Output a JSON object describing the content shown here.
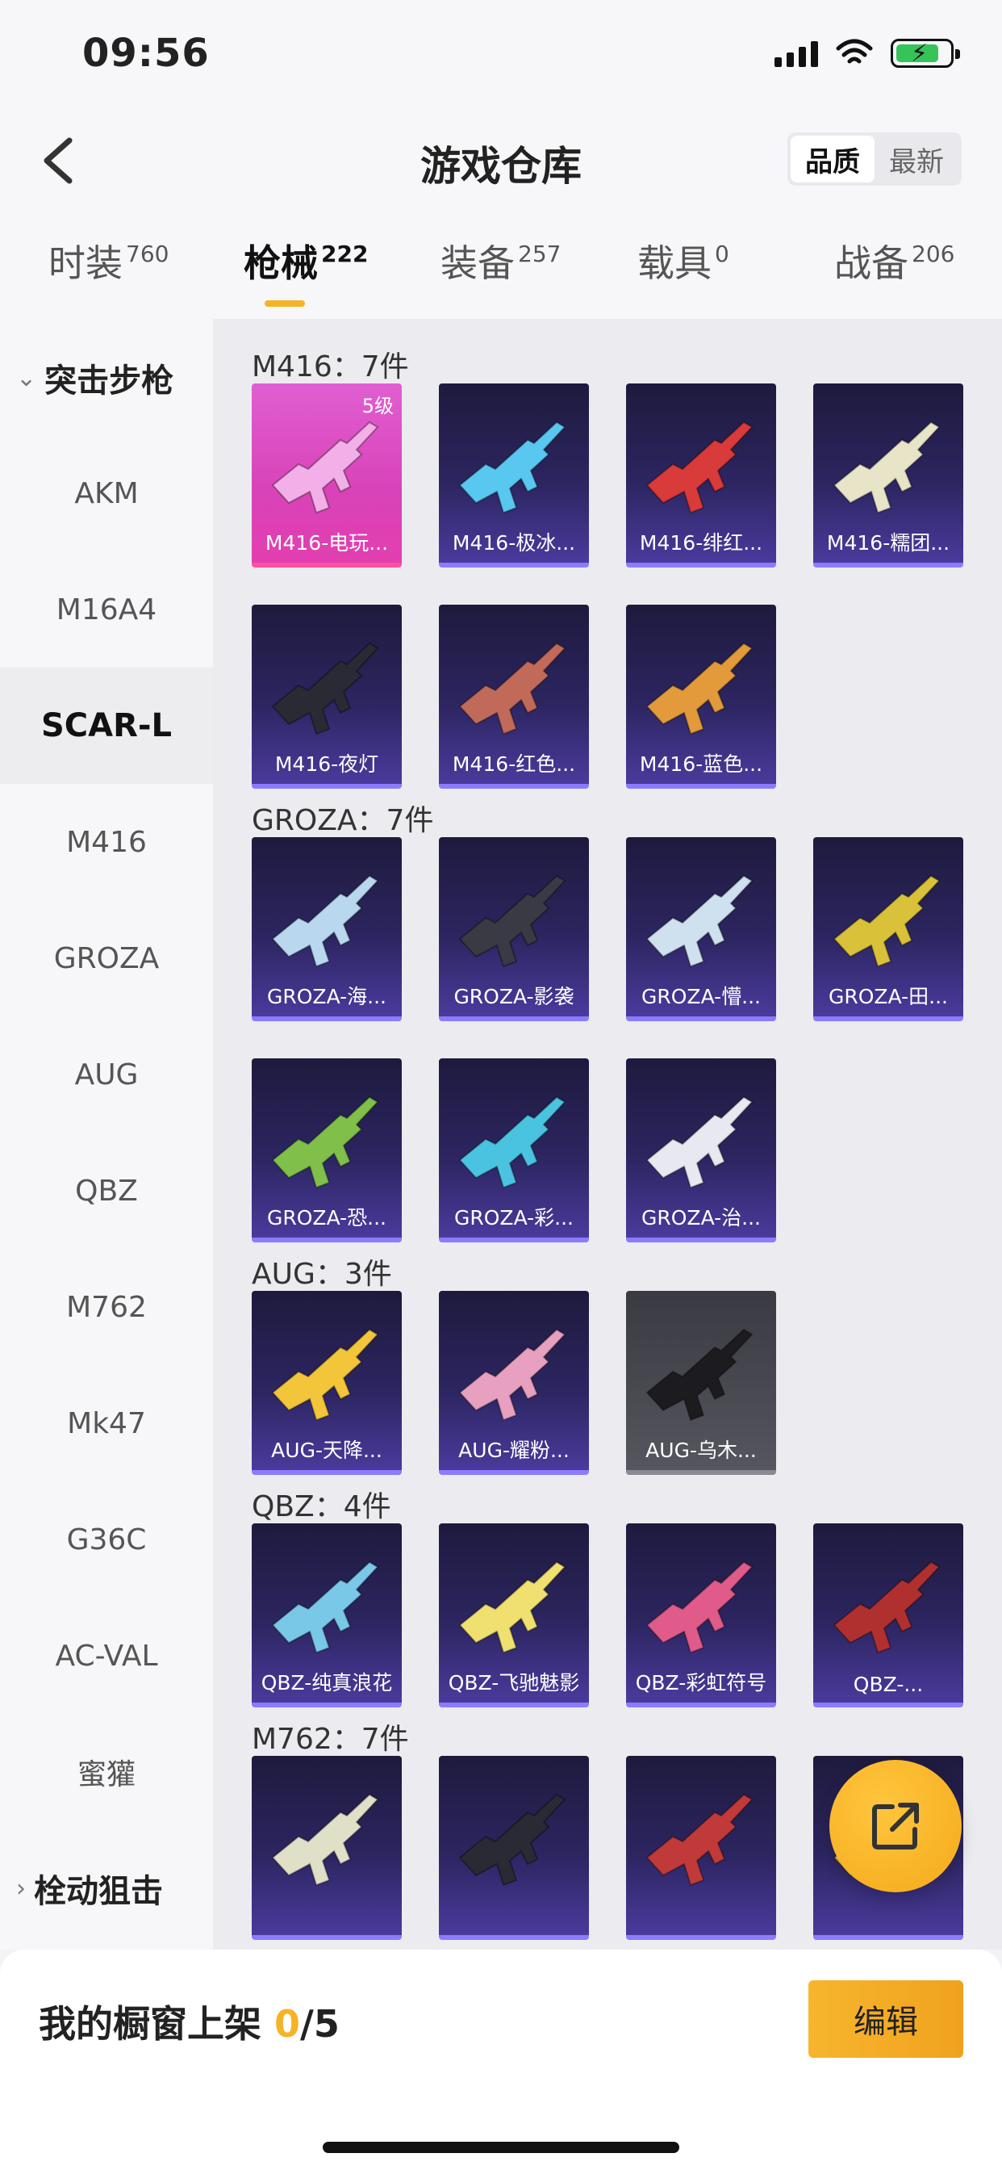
{
  "status": {
    "time": "09:56"
  },
  "header": {
    "title": "游戏仓库",
    "sort_options": [
      "品质",
      "最新"
    ],
    "sort_active": "品质"
  },
  "tabs": [
    {
      "label": "时装",
      "count": "760"
    },
    {
      "label": "枪械",
      "count": "222",
      "active": true
    },
    {
      "label": "装备",
      "count": "257"
    },
    {
      "label": "载具",
      "count": "0"
    },
    {
      "label": "战备",
      "count": "206"
    }
  ],
  "rail": {
    "group_open": "突击步枪",
    "items": [
      "AKM",
      "M16A4",
      "SCAR-L",
      "M416",
      "GROZA",
      "AUG",
      "QBZ",
      "M762",
      "Mk47",
      "G36C",
      "AC-VAL",
      "蜜獾"
    ],
    "active": "SCAR-L",
    "group_closed": "栓动狙击"
  },
  "sections": [
    {
      "title": "M416：7件",
      "items": [
        {
          "name": "M416-电玩...",
          "badge": "5级",
          "style": "pink",
          "gun": "#f3b0e8"
        },
        {
          "name": "M416-极冰...",
          "style": "purple",
          "gun": "#58c8f0"
        },
        {
          "name": "M416-绯红...",
          "style": "purple",
          "gun": "#d93a3a"
        },
        {
          "name": "M416-糯团...",
          "style": "purple",
          "gun": "#e8e4c8"
        },
        {
          "name": "M416-夜灯",
          "style": "purple",
          "gun": "#2a2a35"
        },
        {
          "name": "M416-红色...",
          "style": "purple",
          "gun": "#c26a5a"
        },
        {
          "name": "M416-蓝色...",
          "style": "purple",
          "gun": "#e39a3a"
        }
      ]
    },
    {
      "title": "GROZA：7件",
      "items": [
        {
          "name": "GROZA-海...",
          "style": "purple",
          "gun": "#b9d8f0"
        },
        {
          "name": "GROZA-影袭",
          "style": "purple",
          "gun": "#3a3a45"
        },
        {
          "name": "GROZA-懵...",
          "style": "purple",
          "gun": "#cfe0ee"
        },
        {
          "name": "GROZA-田...",
          "style": "purple",
          "gun": "#d9c23a"
        },
        {
          "name": "GROZA-恐...",
          "style": "purple",
          "gun": "#7fbf4a"
        },
        {
          "name": "GROZA-彩...",
          "style": "purple",
          "gun": "#4ac3e0"
        },
        {
          "name": "GROZA-治...",
          "style": "purple",
          "gun": "#e8e8f0"
        }
      ]
    },
    {
      "title": "AUG：3件",
      "items": [
        {
          "name": "AUG-天降...",
          "style": "purple",
          "gun": "#f3c53a"
        },
        {
          "name": "AUG-耀粉...",
          "style": "purple",
          "gun": "#e8a0c0"
        },
        {
          "name": "AUG-乌木...",
          "style": "gray",
          "gun": "#1c1c20"
        }
      ]
    },
    {
      "title": "QBZ：4件",
      "items": [
        {
          "name": "QBZ-纯真浪花",
          "style": "purple",
          "gun": "#7ac8e8"
        },
        {
          "name": "QBZ-飞驰魅影",
          "style": "purple",
          "gun": "#f0e070"
        },
        {
          "name": "QBZ-彩虹符号",
          "style": "purple",
          "gun": "#e05a8a"
        },
        {
          "name": "QBZ-...",
          "style": "purple",
          "gun": "#b03030"
        }
      ]
    },
    {
      "title": "M762：7件",
      "items": [
        {
          "name": "",
          "style": "purple",
          "gun": "#e0e0c8"
        },
        {
          "name": "",
          "style": "purple",
          "gun": "#2a2a35"
        },
        {
          "name": "",
          "style": "purple",
          "gun": "#c03a3a"
        },
        {
          "name": "",
          "style": "purple",
          "gun": "#e0c040"
        }
      ]
    }
  ],
  "bottom": {
    "label": "我的橱窗上架 ",
    "current": "0",
    "total": "/5",
    "edit_label": "编辑"
  },
  "colors": {
    "accent": "#f5b326",
    "tile_purple": "#2c2560",
    "tile_pink": "#d942b8"
  },
  "icons": {
    "back": "chevron-left-icon",
    "share": "share-icon"
  }
}
